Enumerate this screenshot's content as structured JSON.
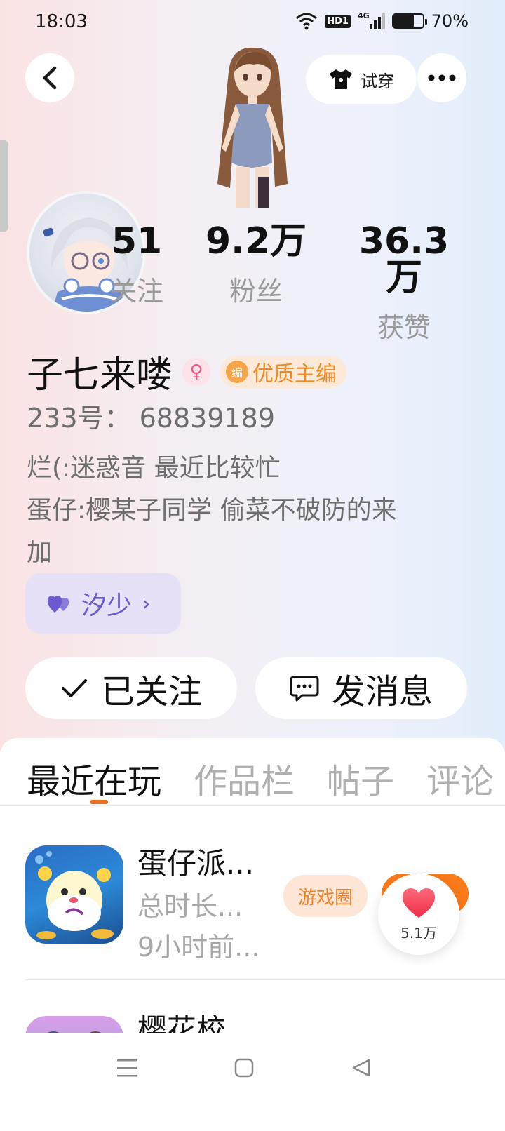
{
  "status_bar": {
    "time": "18:03",
    "network": "4G",
    "hd": "HD1",
    "battery_pct": "70%",
    "battery_level": 0.7
  },
  "header": {
    "try_on_label": "试穿"
  },
  "stats": [
    {
      "value": "51",
      "label": "关注"
    },
    {
      "value": "9.2万",
      "label": "粉丝"
    },
    {
      "value": "36.3万",
      "label": "获赞"
    }
  ],
  "profile": {
    "name": "子七来喽",
    "gender_symbol": "♀",
    "badge_icon_text": "编",
    "badge_label": "优质主编",
    "id_line": "233号：  68839189",
    "bio_lines": [
      "烂(:迷惑音 最近比较忙",
      "蛋仔:樱某子同学 偷菜不破防的来",
      "加"
    ]
  },
  "friend_chip": {
    "name": "汐少",
    "chevron": "›"
  },
  "actions": {
    "follow_label": "已关注",
    "message_label": "发消息"
  },
  "tabs": [
    "最近在玩",
    "作品栏",
    "帖子",
    "评论"
  ],
  "games": [
    {
      "title": "蛋仔派...",
      "duration": "总时长...",
      "last_played": "9小时前...",
      "circle_label": "游戏圈"
    },
    {
      "title": "樱花校..."
    }
  ],
  "like_fab": {
    "count": "5.1万"
  },
  "colors": {
    "accent_orange": "#fb7a1a",
    "friend_purple": "#6b5ad0",
    "badge_orange": "#f08a1e"
  }
}
